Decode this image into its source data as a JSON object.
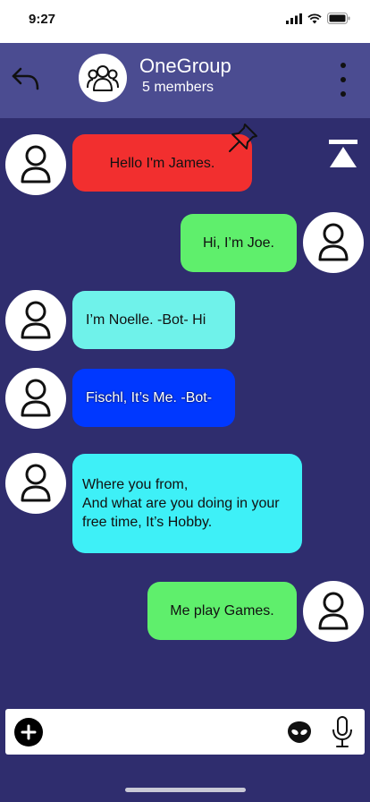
{
  "status_bar": {
    "time": "9:27"
  },
  "header": {
    "group_name": "OneGroup",
    "member_count": "5 members"
  },
  "messages": [
    {
      "sender": "james",
      "text": "Hello I'm James.",
      "color": "#f22f2f",
      "pinned": true
    },
    {
      "sender": "joe",
      "text": "Hi, I’m Joe.",
      "color": "#5fef6c"
    },
    {
      "sender": "noelle",
      "text": "I’m Noelle. -Bot- Hi",
      "color": "#6ff2ea"
    },
    {
      "sender": "fischl",
      "text": "Fischl, It’s Me. -Bot-",
      "color": "#0038ff"
    },
    {
      "sender": "noelle",
      "lines": [
        "Where you from,",
        "And what are you doing in your",
        "free time, It’s Hobby."
      ],
      "color": "#3ef0f7"
    },
    {
      "sender": "joe",
      "text": "Me play Games.",
      "color": "#5fef6c"
    }
  ],
  "composer": {
    "placeholder": ""
  },
  "colors": {
    "background": "#2f2d6e",
    "header": "#4b4c91"
  }
}
